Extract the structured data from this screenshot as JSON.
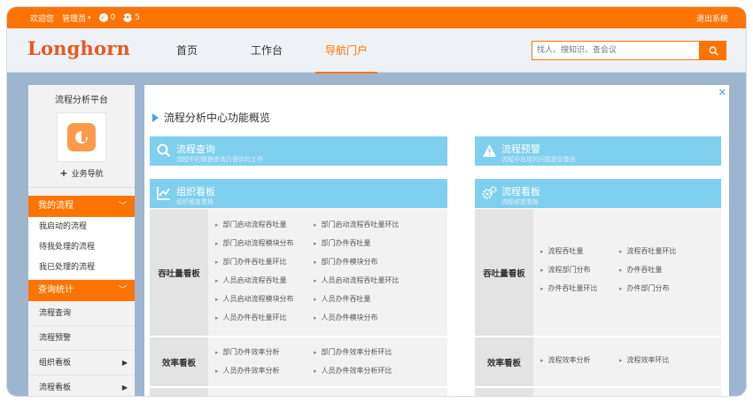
{
  "topbar": {
    "welcome": "欢迎您",
    "user": "管理员",
    "dropdown_glyph": "▾",
    "notice_count": "0",
    "message_count": "5",
    "logout": "退出系统"
  },
  "header": {
    "logo": "Longhorn",
    "nav": [
      "首页",
      "工作台",
      "导航门户"
    ],
    "active_nav": "导航门户",
    "search_placeholder": "找人、搜知识、查会议"
  },
  "sidebar": {
    "platform_title": "流程分析平台",
    "add_label": "业务导航",
    "my_process": {
      "header": "我的流程",
      "items": [
        "我启动的流程",
        "待我处理的流程",
        "我已处理的流程"
      ]
    },
    "query_stats": {
      "header": "查询统计",
      "items": [
        "流程查询",
        "流程预警",
        "组织看板",
        "流程看板"
      ]
    }
  },
  "main": {
    "title": "流程分析中心功能概览",
    "cards": {
      "query": {
        "title": "流程查询",
        "sub": "流程中的数据查询万便你的工作"
      },
      "alert": {
        "title": "流程预警",
        "sub": "流程中出现的问题提前警告"
      },
      "org": {
        "title": "组织看板",
        "sub": "组织维度看板"
      },
      "flow": {
        "title": "流程看板",
        "sub": "流程维度看板"
      }
    },
    "org_panel": {
      "throughput_label": "吞吐量看板",
      "throughput_links": [
        "部门启动流程吞吐量",
        "部门启动流程吞吐量环比",
        "部门启动流程模块分布",
        "部门办件吞吐量",
        "部门办件吞吐量环比",
        "部门办件模块分布",
        "人员启动流程吞吐量",
        "人员启动流程吞吐量环比",
        "人员启动流程模块分布",
        "人员办件吞吐量",
        "人员办件吞吐量环比",
        "人员办件模块分布"
      ],
      "efficiency_label": "效率看板",
      "efficiency_links": [
        "部门办件效率分析",
        "部门办件效率分析环比",
        "人员办件效率分析",
        "人员办件效率分析环比"
      ]
    },
    "flow_panel": {
      "throughput_label": "吞吐量看板",
      "throughput_links": [
        "流程吞吐量",
        "流程吞吐量环比",
        "流程部门分布",
        "办件吞吐量",
        "办件吞吐量环比",
        "办件部门分布"
      ],
      "efficiency_label": "效率看板",
      "efficiency_links": [
        "流程效率分析",
        "流程效率环比"
      ]
    }
  },
  "colors": {
    "accent": "#ff7400",
    "card": "#7fcfee",
    "logo": "#e65a1e"
  }
}
